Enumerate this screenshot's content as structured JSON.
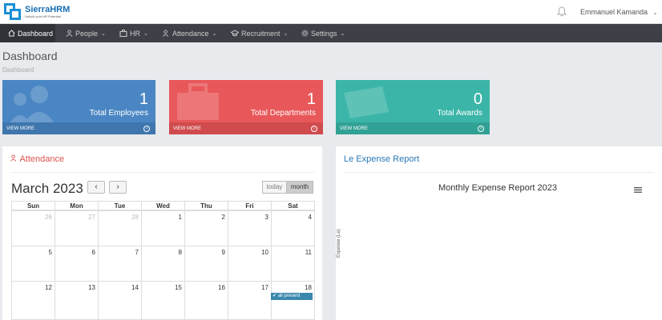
{
  "brand": {
    "name": "SierraHRM",
    "tagline": "Unlock your HR Potential"
  },
  "header": {
    "user_name": "Emmanuel Kamanda",
    "caret": "⌄"
  },
  "nav": [
    {
      "label": "Dashboard",
      "caret": ""
    },
    {
      "label": "People",
      "caret": "⌄"
    },
    {
      "label": "HR",
      "caret": "⌄"
    },
    {
      "label": "Attendance",
      "caret": "⌄"
    },
    {
      "label": "Recruitment",
      "caret": "⌄"
    },
    {
      "label": "Settings",
      "caret": "⌄"
    }
  ],
  "page": {
    "title": "Dashboard",
    "breadcrumb": "Dashboard"
  },
  "cards": [
    {
      "value": "1",
      "label": "Total Employees",
      "more": "VIEW MORE",
      "color": "#4a86c3",
      "foot": "#3f76ae"
    },
    {
      "value": "1",
      "label": "Total Departments",
      "more": "VIEW MORE",
      "color": "#e8585a",
      "foot": "#cf4b4d"
    },
    {
      "value": "0",
      "label": "Total Awards",
      "more": "VIEW MORE",
      "color": "#3bb5a8",
      "foot": "#32a195"
    }
  ],
  "attendance": {
    "title": "Attendance",
    "month_title": "March 2023",
    "prev": "‹",
    "next": "›",
    "today_label": "today",
    "month_label": "month",
    "days": [
      "Sun",
      "Mon",
      "Tue",
      "Wed",
      "Thu",
      "Fri",
      "Sat"
    ],
    "weeks": [
      [
        "26",
        "27",
        "28",
        "1",
        "2",
        "3",
        "4"
      ],
      [
        "5",
        "6",
        "7",
        "8",
        "9",
        "10",
        "11"
      ],
      [
        "12",
        "13",
        "14",
        "15",
        "16",
        "17",
        "18"
      ]
    ],
    "event": "✔ all present"
  },
  "expense": {
    "panel_title": "Le Expense Report",
    "chart_title": "Monthly Expense Report 2023",
    "y_axis_label": "Expense (Le)"
  },
  "chart_data": {
    "type": "bar",
    "title": "Monthly Expense Report 2023",
    "ylabel": "Expense (Le)",
    "xlabel": "",
    "categories": [],
    "values": []
  },
  "colors": {
    "navbar": "#3d4147",
    "accent_blue": "#1a8fd6",
    "attendance_title": "#d9534f",
    "expense_title": "#2a7ab8",
    "event": "#3a87ad"
  }
}
